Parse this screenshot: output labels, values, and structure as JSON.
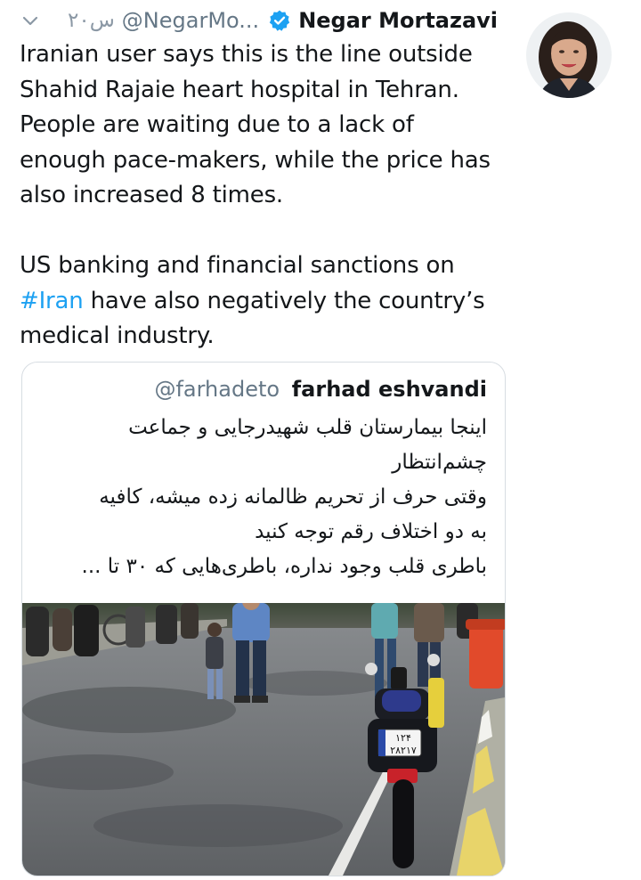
{
  "tweet": {
    "time": "۲۰س",
    "handle": "@NegarMo...",
    "display_name": "Negar Mortazavi",
    "lines": [
      "Iranian user says this is the line outside",
      "Shahid Rajaie heart hospital in Tehran.",
      "People are waiting due to a lack of",
      "enough pace-makers, while the price has",
      "also increased 8 times."
    ],
    "para2": {
      "line1": "US banking and financial sanctions on",
      "hashtag": "#Iran",
      "line2_rest": " have also negatively the country’s",
      "line3": "medical industry."
    }
  },
  "quote": {
    "handle": "@farhadeto",
    "display_name": "farhad eshvandi",
    "lines": [
      "اینجا بیمارستان قلب شهیدرجایی و جماعت",
      "چشم‌انتظار",
      "وقتی حرف از تحریم ظالمانه زده میشه، کافیه",
      "به دو اختلاف رقم توجه کنید",
      "باطری قلب وجود نداره، باطری‌هایی که ۳۰ تا ..."
    ],
    "photo": {
      "plate_top": "۱۲۴",
      "plate_bottom": "۲۸۲۱۷"
    }
  },
  "colors": {
    "link": "#1da1f2",
    "secondary_text": "#657786",
    "primary_text": "#14171a",
    "border": "#d7dde2",
    "verified_badge": "#1da1f2"
  },
  "icons": {
    "menu": "chevron-down-icon",
    "verified": "verified-badge-icon"
  }
}
